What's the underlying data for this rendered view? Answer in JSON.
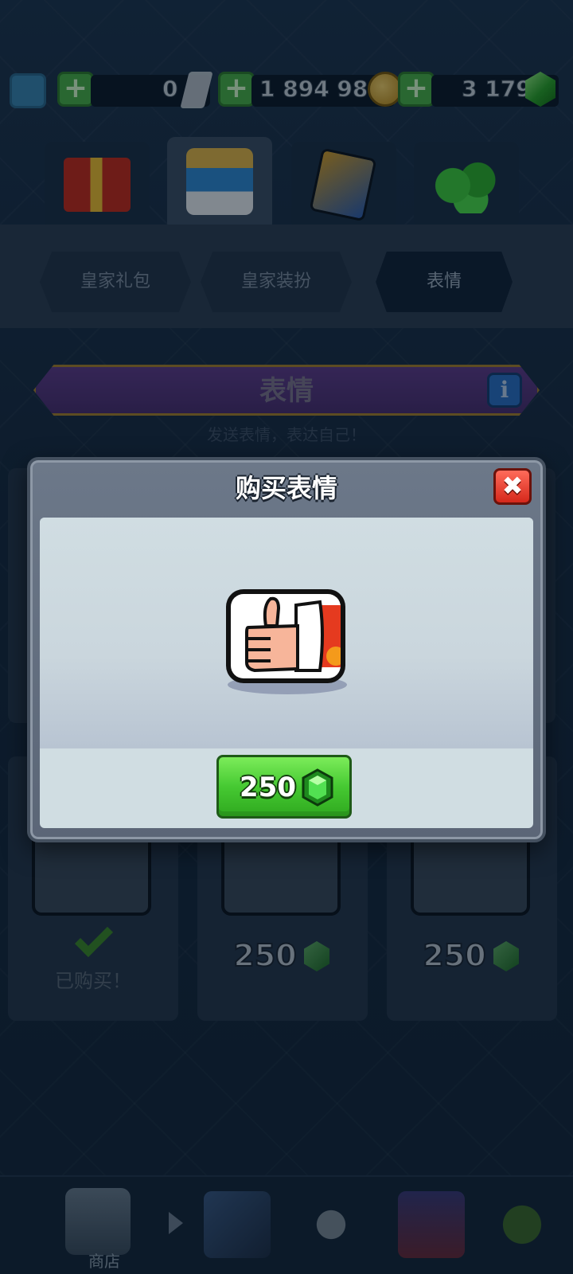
{
  "resources": {
    "tickets": "0",
    "gold": "1 894 980",
    "gems": "3 179"
  },
  "shop_tabs": [
    {
      "icon": "gift-icon",
      "active": false
    },
    {
      "icon": "tower-icon",
      "active": true
    },
    {
      "icon": "cards-icon",
      "active": false
    },
    {
      "icon": "gems-pile-icon",
      "active": false
    }
  ],
  "subtabs": [
    "皇家礼包",
    "皇家装扮",
    "表情"
  ],
  "section": {
    "title": "表情",
    "subtitle": "发送表情，表达自己！"
  },
  "cards": [
    {
      "status": "已购买！"
    },
    {
      "price": "250"
    },
    {
      "price": "250"
    }
  ],
  "bottom_nav": {
    "shop_label": "商店"
  },
  "modal": {
    "title": "购买表情",
    "close_symbol": "✖",
    "price": "250",
    "emote": "thumbs-up-emote"
  },
  "colors": {
    "buy_button": "#46c932",
    "close_button": "#d5281b",
    "gem": "#2aa52a"
  }
}
